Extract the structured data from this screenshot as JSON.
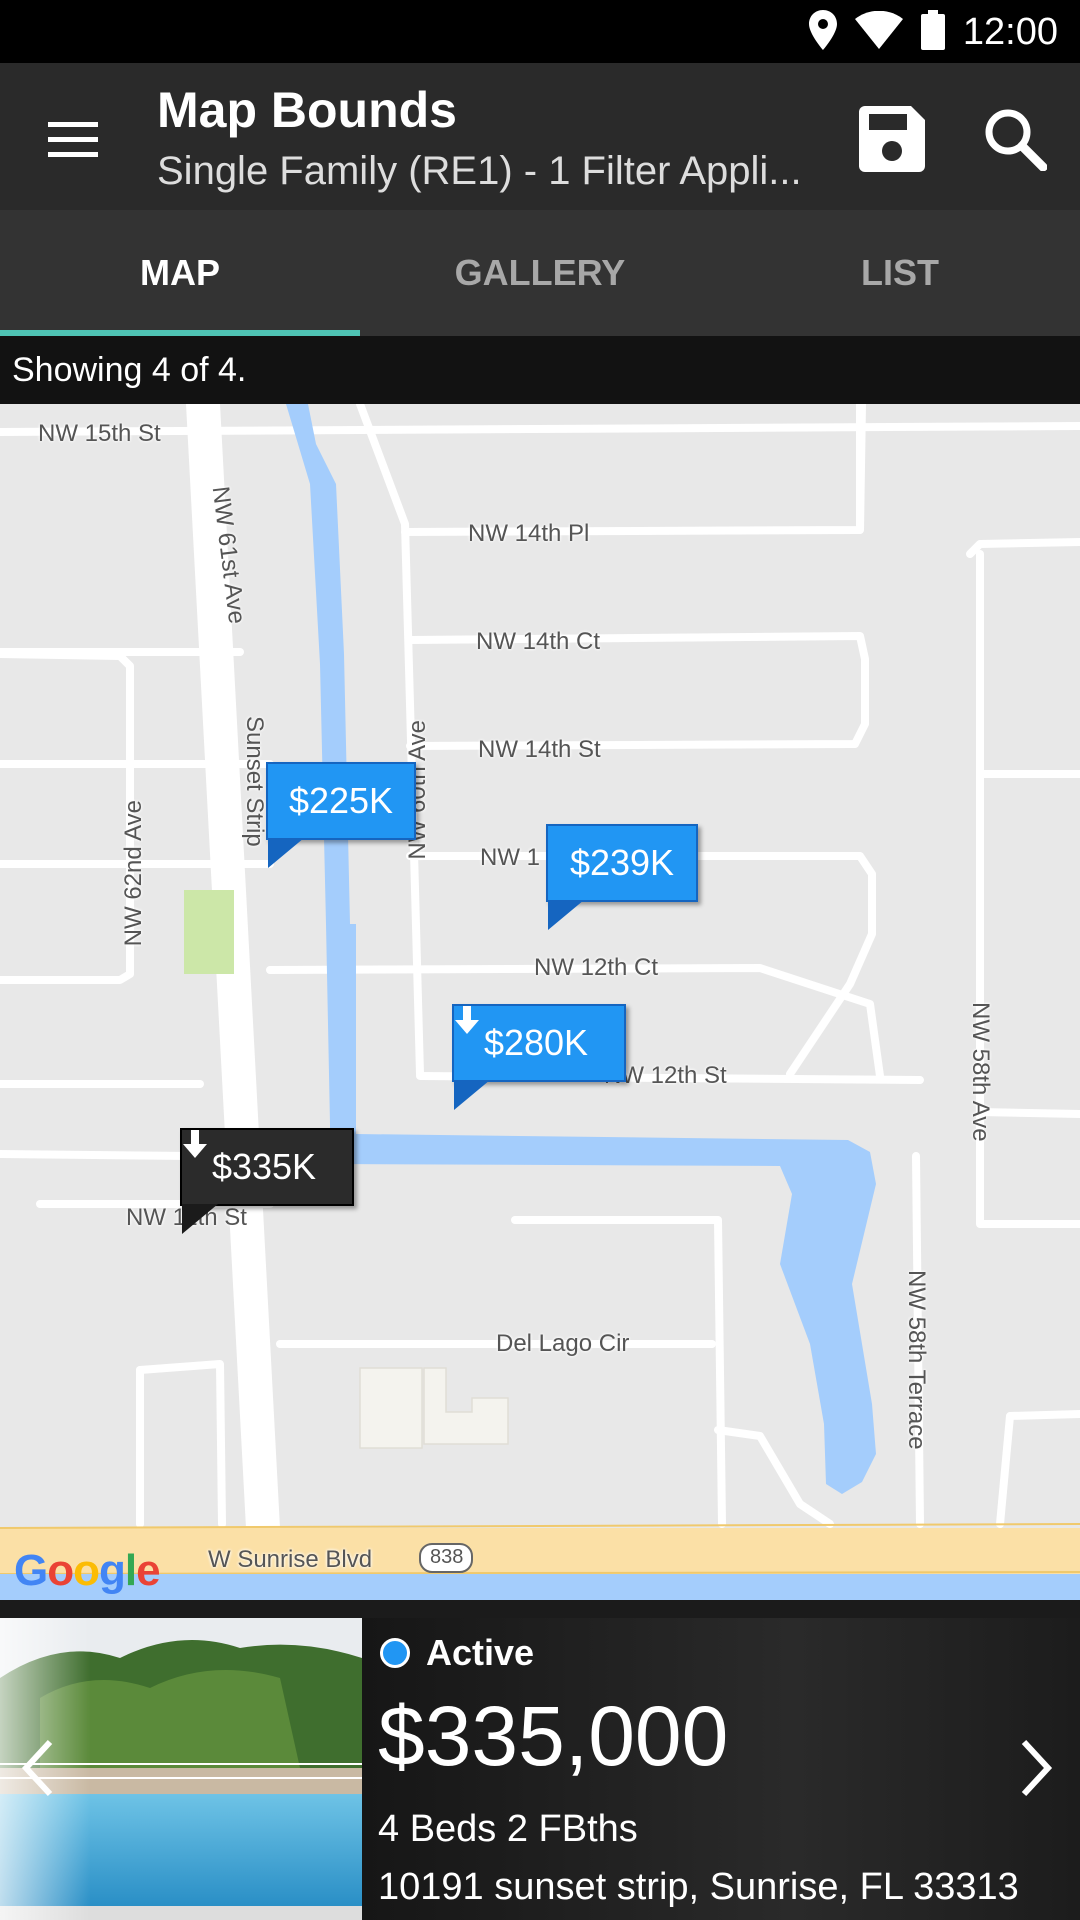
{
  "status_bar": {
    "time": "12:00",
    "icons": [
      "location-icon",
      "wifi-icon",
      "battery-icon"
    ]
  },
  "app_bar": {
    "title": "Map Bounds",
    "subtitle": "Single Family (RE1) - 1 Filter Appli...",
    "icons": [
      "menu-icon",
      "save-icon",
      "search-icon"
    ]
  },
  "tabs": [
    {
      "label": "MAP",
      "active": true
    },
    {
      "label": "GALLERY",
      "active": false
    },
    {
      "label": "LIST",
      "active": false
    }
  ],
  "results": {
    "summary": "Showing 4 of 4."
  },
  "map": {
    "streets": [
      "NW 15th St",
      "NW 61st Ave",
      "NW 14th Pl",
      "NW 14th Ct",
      "NW 14th St",
      "Sunset Strip",
      "NW 60th Ave",
      "NW 62nd Ave",
      "NW 1",
      "NW 12th Ct",
      "NW 12th St",
      "NW 58th Ave",
      "NW 11th St",
      "Del Lago Cir",
      "NW 58th Terrace",
      "W Sunrise Blvd",
      "838"
    ],
    "pins": [
      {
        "label": "$225K",
        "style": "blue",
        "reduced": false
      },
      {
        "label": "$239K",
        "style": "blue",
        "reduced": false
      },
      {
        "label": "$280K",
        "style": "blue",
        "reduced": true
      },
      {
        "label": "$335K",
        "style": "dark",
        "reduced": true
      }
    ],
    "attribution": "Google",
    "colors": {
      "water": "#a4cdfc",
      "park": "#cce7a8",
      "highway": "#fbe0a6",
      "land": "#e8e8e8"
    }
  },
  "listing": {
    "status": "Active",
    "price": "$335,000",
    "beds_baths": "4 Beds 2 FBths",
    "address": "10191 sunset strip, Sunrise, FL 33313",
    "status_color": "#2196f3"
  }
}
